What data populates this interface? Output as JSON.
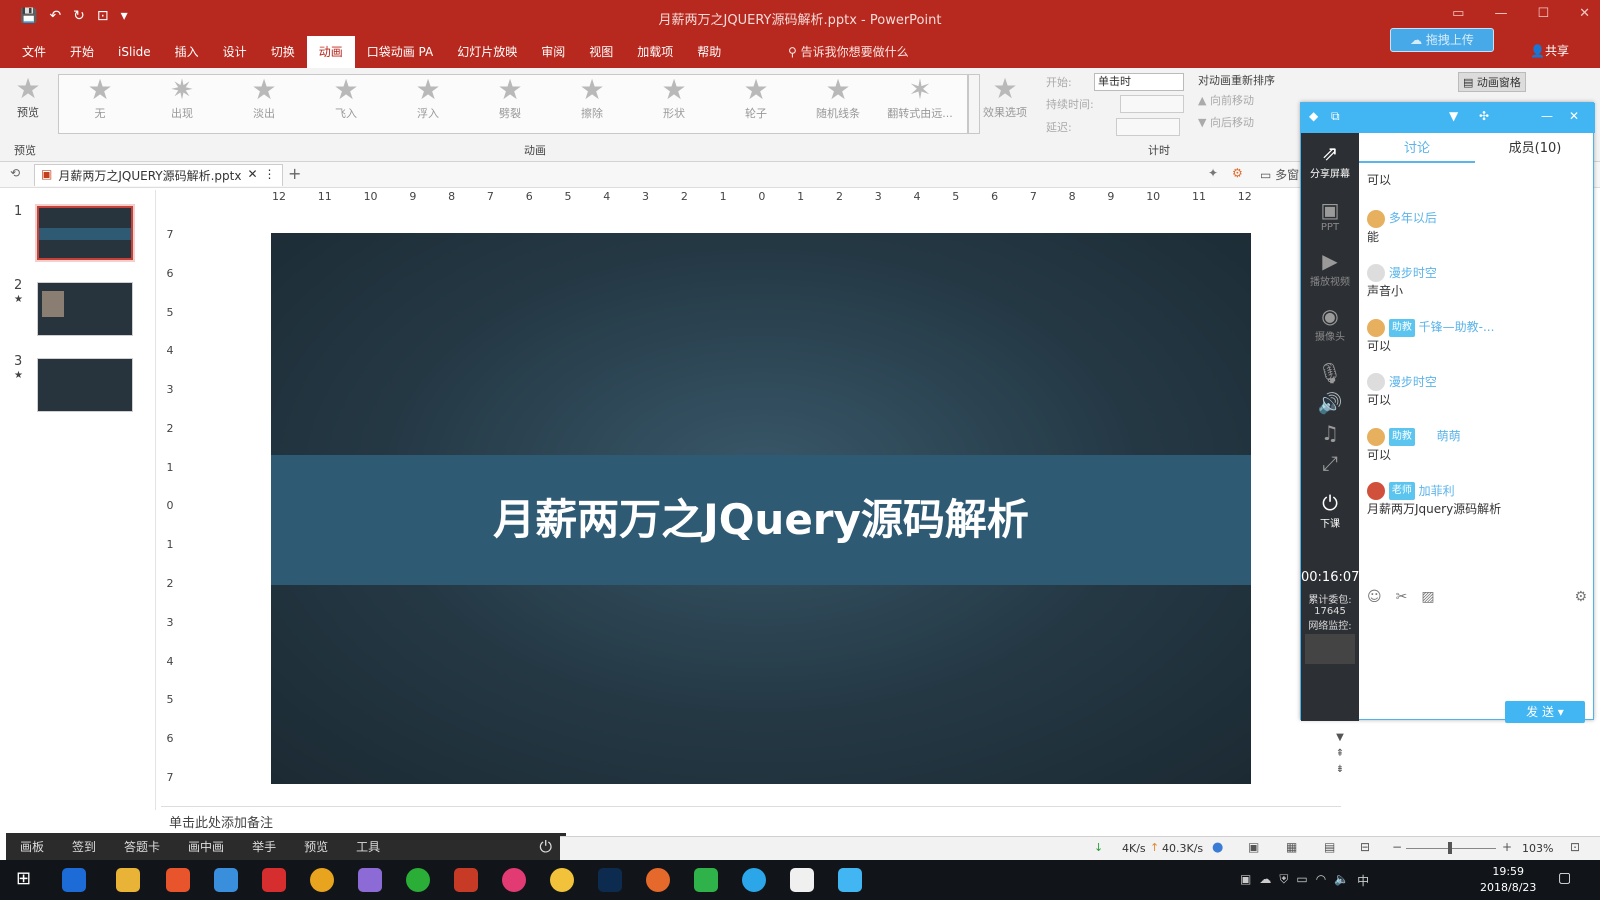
{
  "window": {
    "title": "月薪两万之JQUERY源码解析.pptx  -  PowerPoint",
    "upload_label": "拖拽上传",
    "share_label": "共享",
    "colors": {
      "ribbon_red": "#b7281e",
      "accent_blue": "#41b6f2"
    }
  },
  "menu": {
    "tabs": [
      {
        "label": "文件"
      },
      {
        "label": "开始"
      },
      {
        "label": "iSlide"
      },
      {
        "label": "插入"
      },
      {
        "label": "设计"
      },
      {
        "label": "切换"
      },
      {
        "label": "动画"
      },
      {
        "label": "口袋动画 PA"
      },
      {
        "label": "幻灯片放映"
      },
      {
        "label": "审阅"
      },
      {
        "label": "视图"
      },
      {
        "label": "加载项"
      },
      {
        "label": "帮助"
      }
    ],
    "active_tab": "动画",
    "tell_me": "告诉我你想要做什么"
  },
  "ribbon": {
    "preview_label": "预览",
    "preview_group": "预览",
    "animations": [
      "无",
      "出现",
      "淡出",
      "飞入",
      "浮入",
      "劈裂",
      "擦除",
      "形状",
      "轮子",
      "随机线条",
      "翻转式由远..."
    ],
    "effect_options": "效果选项",
    "anim_group": "动画",
    "start_label": "开始:",
    "start_value": "单击时",
    "duration_label": "持续时间:",
    "delay_label": "延迟:",
    "reorder_label": "对动画重新排序",
    "move_earlier": "向前移动",
    "move_later": "向后移动",
    "timing_group": "计时",
    "anim_pane": "动画窗格"
  },
  "doc_tab": {
    "name": "月薪两万之JQUERY源码解析.pptx",
    "multi_label": "多窗"
  },
  "ruler": {
    "h_ticks": [
      "12",
      "11",
      "10",
      "9",
      "8",
      "7",
      "6",
      "5",
      "4",
      "3",
      "2",
      "1",
      "0",
      "1",
      "2",
      "3",
      "4",
      "5",
      "6",
      "7",
      "8",
      "9",
      "10",
      "11",
      "12"
    ],
    "v_ticks": [
      "7",
      "6",
      "5",
      "4",
      "3",
      "2",
      "1",
      "0",
      "1",
      "2",
      "3",
      "4",
      "5",
      "6",
      "7"
    ]
  },
  "slides": [
    {
      "num": "1"
    },
    {
      "num": "2"
    },
    {
      "num": "3"
    }
  ],
  "slide": {
    "title": "月薪两万之JQuery源码解析"
  },
  "notes_placeholder": "单击此处添加备注",
  "floatbar": [
    "画板",
    "签到",
    "答题卡",
    "画中画",
    "举手",
    "预览",
    "工具"
  ],
  "status": {
    "down": "4K/s",
    "up": "40.3K/s",
    "zoom": "103%"
  },
  "live": {
    "side_items": [
      {
        "label": "分享屏幕",
        "icon": "share-screen-icon"
      },
      {
        "label": "PPT",
        "icon": "ppt-icon"
      },
      {
        "label": "播放视频",
        "icon": "video-icon"
      },
      {
        "label": "摄像头",
        "icon": "camera-icon"
      },
      {
        "label": "下课",
        "icon": "end-class-icon"
      }
    ],
    "timer": "00:16:07",
    "total_label": "累计委包:",
    "total_value": "17645",
    "net_label": "网络监控:",
    "tabs": {
      "discuss": "讨论",
      "members": "成员(10)"
    },
    "messages": [
      {
        "name": "",
        "badge": "",
        "text": "可以"
      },
      {
        "name": "多年以后",
        "badge": "",
        "text": "能"
      },
      {
        "name": "漫步时空",
        "badge": "",
        "text": "声音小"
      },
      {
        "name": "千锋—助教-...",
        "badge": "助教",
        "text": "可以"
      },
      {
        "name": "漫步时空",
        "badge": "",
        "text": "可以"
      },
      {
        "name": "萌萌",
        "badge": "助教",
        "text": "可以"
      },
      {
        "name": "加菲利",
        "badge": "老师",
        "text": "月薪两万Jquery源码解析"
      }
    ],
    "send_label": "发 送"
  },
  "taskbar": {
    "time": "19:59",
    "date": "2018/8/23",
    "ime": "中"
  }
}
